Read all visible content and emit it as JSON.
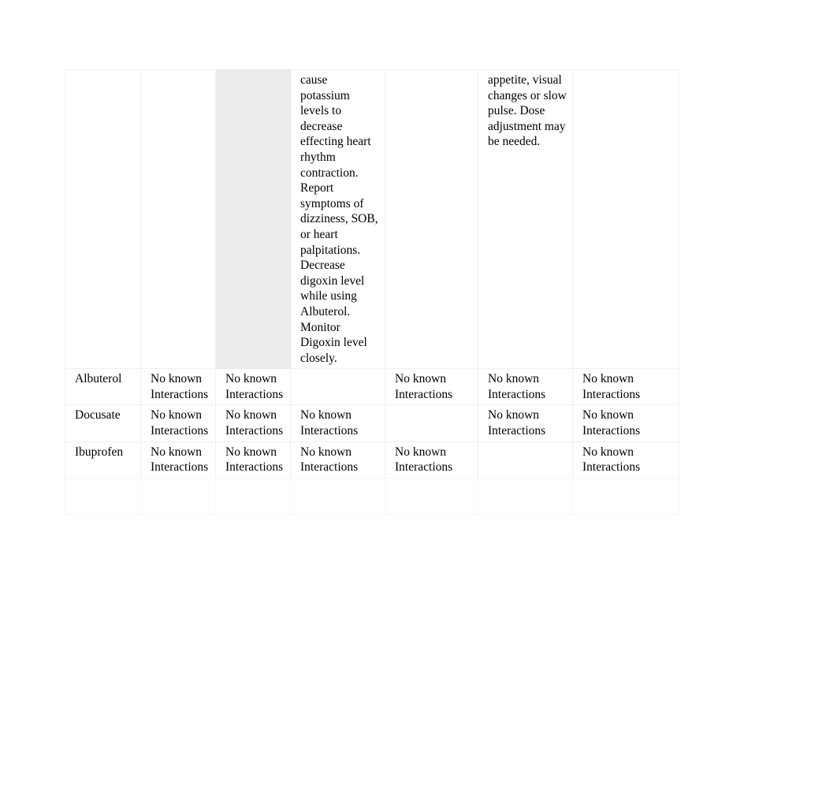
{
  "document": {
    "type": "drug-interaction-table",
    "page_background": "#ffffff",
    "text_color": "#000000",
    "border_color": "#f0f0f0",
    "shaded_cell_color": "#ececec"
  },
  "table": {
    "continuation_row": {
      "col_drug": "",
      "col_i1": "",
      "col_i2": "",
      "col_i3": "cause potassium levels to decrease effecting heart rhythm contraction. Report symptoms of dizziness, SOB, or heart palpitations. Decrease digoxin level while using Albuterol. Monitor Digoxin level closely.",
      "col_i4": "",
      "col_i5": "appetite, visual changes or slow pulse. Dose adjustment may be needed.",
      "col_i6": ""
    },
    "no_known": "No known Interactions",
    "rows": [
      {
        "drug": "Albuterol",
        "cells": [
          "No known Interactions",
          "No known Interactions",
          "",
          "No known Interactions",
          "No known Interactions",
          "No known Interactions"
        ]
      },
      {
        "drug": "Docusate",
        "cells": [
          "No known Interactions",
          "No known Interactions",
          "No known Interactions",
          "",
          "No known Interactions",
          "No known Interactions"
        ]
      },
      {
        "drug": "Ibuprofen",
        "cells": [
          "No known Interactions",
          "No known Interactions",
          "No known Interactions",
          "No known Interactions",
          "",
          "No known Interactions"
        ]
      },
      {
        "drug": "",
        "cells": [
          "",
          "",
          "",
          "",
          "",
          ""
        ]
      }
    ]
  },
  "footer": {
    "line_1": "",
    "line_2": ""
  }
}
